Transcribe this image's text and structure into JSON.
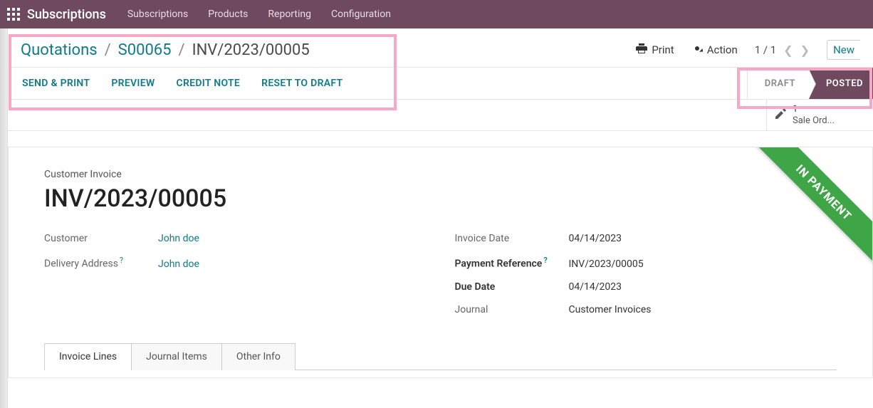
{
  "topbar": {
    "app_title": "Subscriptions",
    "menu": [
      "Subscriptions",
      "Products",
      "Reporting",
      "Configuration"
    ]
  },
  "breadcrumb": {
    "root": "Quotations",
    "mid": "S00065",
    "current": "INV/2023/00005"
  },
  "toolbar": {
    "print": "Print",
    "action": "Action",
    "pager": "1 / 1",
    "new": "New"
  },
  "actions": {
    "send_print": "SEND & PRINT",
    "preview": "PREVIEW",
    "credit_note": "CREDIT NOTE",
    "reset_draft": "RESET TO DRAFT"
  },
  "status": {
    "draft": "DRAFT",
    "posted": "POSTED"
  },
  "substat": {
    "count": "1",
    "label": "Sale Ord..."
  },
  "ribbon": "IN PAYMENT",
  "form": {
    "title_small": "Customer Invoice",
    "title": "INV/2023/00005",
    "left": {
      "customer_lbl": "Customer",
      "customer_val": "John doe",
      "delivery_lbl": "Delivery Address",
      "delivery_val": "John doe"
    },
    "right": {
      "invoice_date_lbl": "Invoice Date",
      "invoice_date_val": "04/14/2023",
      "payment_ref_lbl": "Payment Reference",
      "payment_ref_val": "INV/2023/00005",
      "due_date_lbl": "Due Date",
      "due_date_val": "04/14/2023",
      "journal_lbl": "Journal",
      "journal_val": "Customer Invoices"
    }
  },
  "tabs": [
    "Invoice Lines",
    "Journal Items",
    "Other Info"
  ]
}
